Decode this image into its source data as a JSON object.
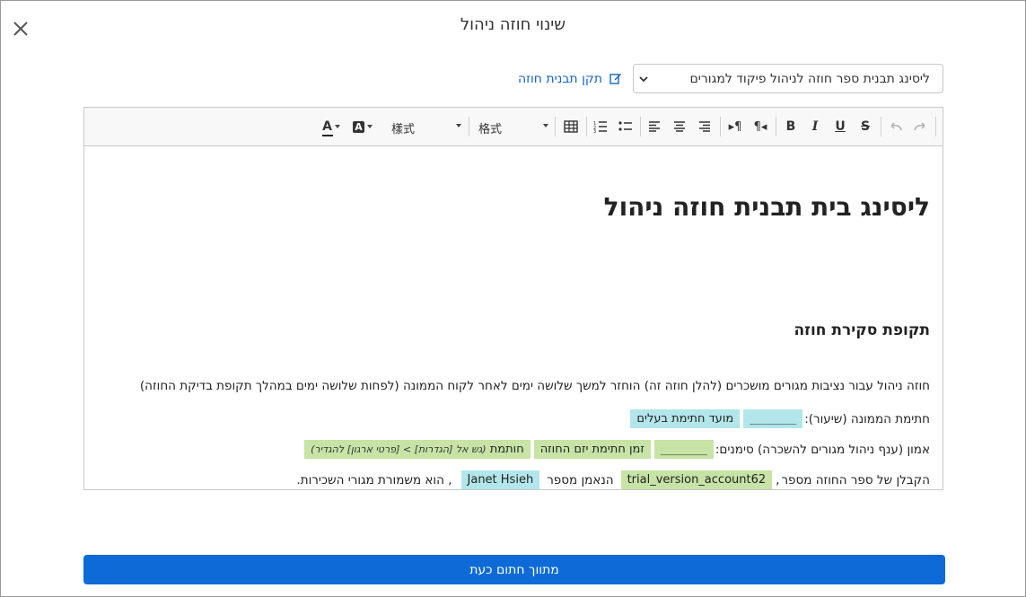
{
  "dialog": {
    "title": "שינוי חוזה ניהול"
  },
  "template_select": {
    "value": "ליסינג תבנית ספר חוזה לניהול פיקוד למגורים"
  },
  "fix_template_link": "תקן תבנית חוזה",
  "toolbar": {
    "font_color": "A",
    "highlight": "A",
    "style_dropdown": "樣式",
    "format_dropdown": "格式",
    "bold": "B",
    "italic": "I",
    "underline": "U",
    "strike": "S"
  },
  "document": {
    "heading": "ליסינג בית תבנית חוזה ניהול",
    "section_title": "תקופת סקירת חוזה",
    "para1": "חוזה ניהול עבור נציבות מגורים מושכרים (להלן חוזה זה) הוחזר למשך שלושה ימים לאחר לקוח הממונה (לפחות שלושה ימים במהלך תקופת בדיקת החוזה)",
    "line2_label": "חתימת הממונה (שיעור):",
    "line2_sig": "________",
    "line2_chip": "מועד חתימת בעלים",
    "line3_label": "אמון (ענף ניהול מגורים להשכרה) סימנים:",
    "line3_sig": "________",
    "line3_chip1": "זמן חתימת יזם החוזה",
    "line3_chip2_main": "חותמת",
    "line3_chip2_note": "(גש אל [הגדרות] > [פרטי ארגון] להגדיר)",
    "line4_label": "הקבלן של ספר החוזה מספר",
    "line4_account": "trial_version_account62",
    "line4_mid": "הנאמן מספר",
    "line4_name": "Janet Hsieh",
    "line4_end": ", הוא משמורת מגורי השכירות."
  },
  "primary_button": "מתווך חתום כעת",
  "colors": {
    "primary": "#0d6ad6",
    "chip_blue": "#b2e6ea",
    "chip_green": "#c7e3a6",
    "link": "#1565c0"
  }
}
